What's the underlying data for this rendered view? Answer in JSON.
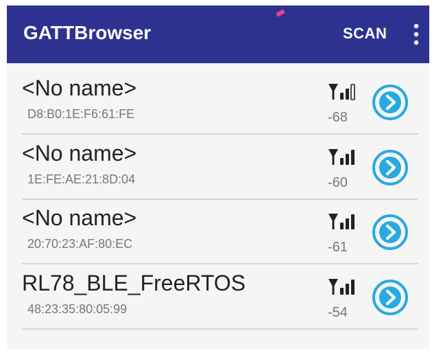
{
  "app_bar": {
    "title": "GATTBrowser",
    "scan_label": "SCAN",
    "more_icon": "more-vert-icon",
    "color": "#2d3291"
  },
  "devices": [
    {
      "name": "<No name>",
      "address": "D8:B0:1E:F6:61:FE",
      "rssi": "-68",
      "signal_bars": 2
    },
    {
      "name": "<No name>",
      "address": "1E:FE:AE:21:8D:04",
      "rssi": "-60",
      "signal_bars": 3
    },
    {
      "name": "<No name>",
      "address": "20:70:23:AF:80:EC",
      "rssi": "-61",
      "signal_bars": 3
    },
    {
      "name": "RL78_BLE_FreeRTOS",
      "address": "48:23:35:80:05:99",
      "rssi": "-54",
      "signal_bars": 3
    }
  ],
  "colors": {
    "accent": "#29a9e1",
    "signal": "#222222"
  },
  "icons": {
    "signal": "signal-strength-icon",
    "connect": "play-arrow-circle-icon"
  }
}
